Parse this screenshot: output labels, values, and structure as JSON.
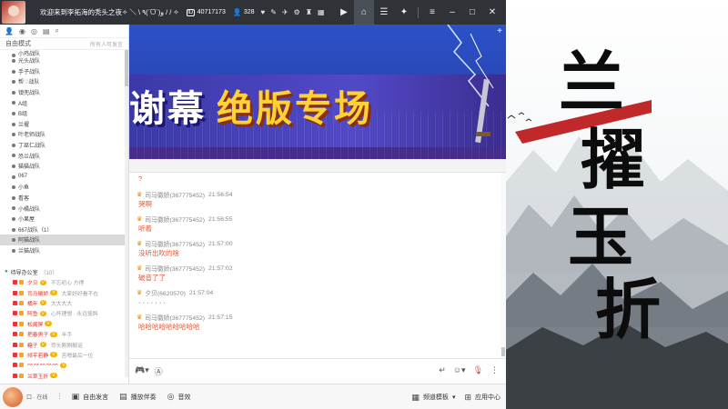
{
  "titlebar": {
    "title": "欢迎来到李拓海的秃头之夜✧ ＼ \\ ٩(ˊᗜˋ)و / / ✧",
    "room_id": "40717173",
    "online_count": "328",
    "icons": [
      "heart-icon",
      "wrench-icon",
      "plane-icon",
      "gear-icon",
      "shirt-icon",
      "grid-icon"
    ],
    "right_buttons": [
      "video-icon",
      "home-icon",
      "list-icon",
      "gamepad-icon",
      "menu-icon",
      "minimize-icon",
      "maximize-icon",
      "close-icon"
    ]
  },
  "left_panel": {
    "mode_label": "自由模式",
    "search_placeholder": "所有人可发言",
    "channels": [
      "小鸡战队",
      "光头战队",
      "手子战队",
      "帮♡战队",
      "镇兜战队",
      "A组",
      "B组",
      "兰擢",
      "叶老师战队",
      "丁巫仁战队",
      "恐兰战队",
      "猫猫战队",
      "067",
      "小鱼",
      "看客",
      "小橘战队",
      "小果屋",
      "667战队（1）",
      "阿猫战队",
      "兰猫战队"
    ],
    "selected_channel": "阿猫战队",
    "section_label": "待导办公室",
    "section_count": "（10）",
    "members": [
      {
        "name": "夕贝",
        "badge": "V",
        "desc": "不忘初心 方得"
      },
      {
        "name": "司马徽娇",
        "badge": "V",
        "desc": "大家好好看不在"
      },
      {
        "name": "橘年",
        "badge": "V",
        "desc": "大大大大"
      },
      {
        "name": "阿鱼",
        "badge": "V",
        "desc": "心怀理想 · 永远笼鸽"
      },
      {
        "name": "松阁屏",
        "badge": "V",
        "desc": ""
      },
      {
        "name": "把春男子",
        "badge": "V",
        "desc": "半手"
      },
      {
        "name": "糖子",
        "badge": "V",
        "desc": "苟头刚刚靓运"
      },
      {
        "name": "倾平若静",
        "badge": "V",
        "desc": "苦嗯最后一位"
      },
      {
        "name": "ᨐᨐᨐᨐᨐ",
        "badge": "V",
        "desc": ""
      },
      {
        "name": "兰草玉折",
        "badge": "V",
        "desc": ""
      }
    ]
  },
  "video": {
    "banner_left": "谢幕",
    "banner_right": "绝版专场"
  },
  "chat": {
    "first_line": "?",
    "messages": [
      {
        "sender": "司马徽娇(367775452)",
        "time": "21:56:54",
        "text": "哭啊",
        "dark": false
      },
      {
        "sender": "司马徽娇(367775452)",
        "time": "21:56:55",
        "text": "听着",
        "dark": false
      },
      {
        "sender": "司马徽娇(367775452)",
        "time": "21:57:00",
        "text": "没听出吹的啥",
        "dark": false
      },
      {
        "sender": "司马徽娇(367775452)",
        "time": "21:57:02",
        "text": "破音了了",
        "dark": false
      },
      {
        "sender": "夕贝(6620570)",
        "time": "21:57:04",
        "text": "· · · · · · ·",
        "dark": true
      },
      {
        "sender": "司马徽娇(367775452)",
        "time": "21:57:15",
        "text": "哈哈哈哈哈哈哈哈哈",
        "dark": false
      }
    ]
  },
  "bottombar": {
    "user_label": "口 · 在线",
    "free_speech": "自由发言",
    "play_accompany": "播放伴奏",
    "sound_effect": "音效",
    "template_label": "频道模板",
    "app_center": "应用中心"
  },
  "promo": {
    "characters": [
      "兰",
      "擢",
      "玉",
      "折"
    ]
  }
}
